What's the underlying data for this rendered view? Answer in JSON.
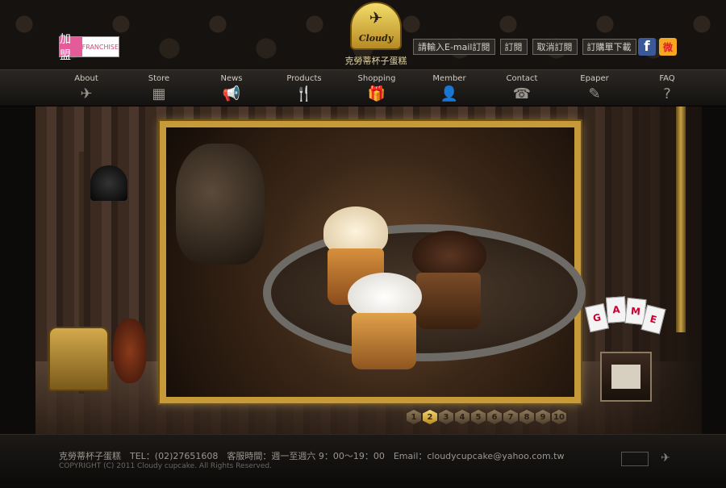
{
  "header": {
    "franchise_cn": "加盟",
    "franchise_en": "FRANCHISE",
    "logo_text": "Cloudy",
    "logo_cn": "克勞蒂杯子蛋糕",
    "subscribe_input_label": "請輸入E-mail訂閱",
    "subscribe_label": "訂閱",
    "unsubscribe_label": "取消訂閱",
    "order_download_label": "訂購單下載",
    "facebook_glyph": "f",
    "weibo_glyph": "微"
  },
  "nav": [
    {
      "label": "About",
      "icon": "cupid-icon",
      "glyph": "✈"
    },
    {
      "label": "Store",
      "icon": "store-icon",
      "glyph": "▦"
    },
    {
      "label": "News",
      "icon": "megaphone-icon",
      "glyph": "📢"
    },
    {
      "label": "Products",
      "icon": "cutlery-icon",
      "glyph": "🍴"
    },
    {
      "label": "Shopping",
      "icon": "gift-icon",
      "glyph": "🎁"
    },
    {
      "label": "Member",
      "icon": "person-icon",
      "glyph": "👤"
    },
    {
      "label": "Contact",
      "icon": "telephone-icon",
      "glyph": "☎"
    },
    {
      "label": "Epaper",
      "icon": "newspaper-icon",
      "glyph": "✎"
    },
    {
      "label": "FAQ",
      "icon": "question-icon",
      "glyph": "?"
    }
  ],
  "game": {
    "cards": [
      "G",
      "A",
      "M",
      "E"
    ]
  },
  "pager": {
    "pages": [
      "1",
      "2",
      "3",
      "4",
      "5",
      "6",
      "7",
      "8",
      "9",
      "10"
    ],
    "active": "2"
  },
  "footer": {
    "info": "克勞蒂杯子蛋糕　TEL：(02)27651608　客服時間：週一至週六 9：00～19：00　Email：cloudycupcake@yahoo.com.tw",
    "copyright": "COPYRIGHT (C) 2011 Cloudy cupcake. All Rights Reserved."
  }
}
